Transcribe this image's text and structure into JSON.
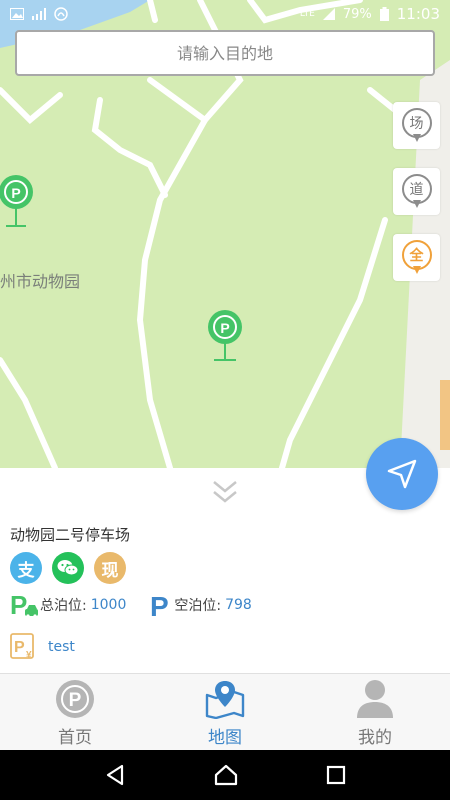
{
  "statusbar": {
    "time": "11:03",
    "battery": "79%",
    "network": "LTE"
  },
  "search": {
    "placeholder": "请输入目的地"
  },
  "filters": [
    {
      "label": "场"
    },
    {
      "label": "道"
    },
    {
      "label": "全"
    }
  ],
  "map": {
    "place_label": "州市动物园"
  },
  "lot": {
    "name": "动物园二号停车场",
    "total_label": "总泊位:",
    "total_value": "1000",
    "free_label": "空泊位:",
    "free_value": "798",
    "note": "test"
  },
  "payments": [
    {
      "name": "alipay",
      "glyph": "支"
    },
    {
      "name": "wechat",
      "glyph": "wechat-icon"
    },
    {
      "name": "cash",
      "glyph": "现"
    }
  ],
  "tabs": [
    {
      "label": "首页"
    },
    {
      "label": "地图"
    },
    {
      "label": "我的"
    }
  ],
  "colors": {
    "accent": "#3d86c9",
    "parking_green": "#45c467",
    "map_green": "#d5ecb4",
    "locate_blue": "#58a0f0"
  }
}
